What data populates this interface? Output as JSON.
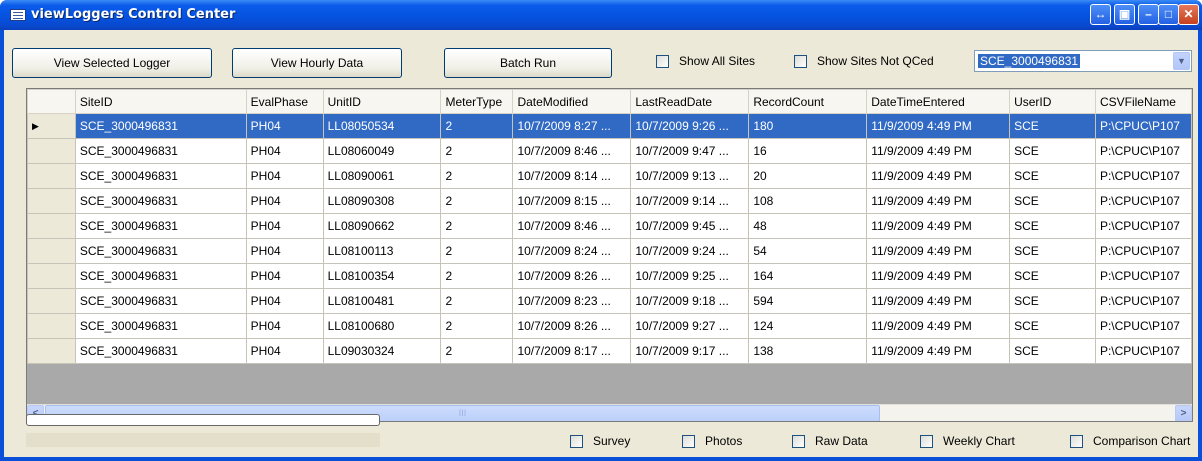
{
  "window": {
    "title": "viewLoggers Control Center"
  },
  "toolbar": {
    "view_selected_logger": "View Selected Logger",
    "view_hourly_data": "View Hourly Data",
    "batch_run": "Batch Run",
    "show_all_sites": "Show All Sites",
    "show_sites_not_qced": "Show Sites Not QCed",
    "site_select_value": "SCE_3000496831"
  },
  "grid": {
    "columns": [
      "SiteID",
      "EvalPhase",
      "UnitID",
      "MeterType",
      "DateModified",
      "LastReadDate",
      "RecordCount",
      "DateTimeEntered",
      "UserID",
      "CSVFileName"
    ],
    "rows": [
      [
        "SCE_3000496831",
        "PH04",
        "LL08050534",
        "2",
        "10/7/2009 8:27 ...",
        "10/7/2009 9:26 ...",
        "180",
        "11/9/2009 4:49 PM",
        "SCE",
        "P:\\CPUC\\P107"
      ],
      [
        "SCE_3000496831",
        "PH04",
        "LL08060049",
        "2",
        "10/7/2009 8:46 ...",
        "10/7/2009 9:47 ...",
        "16",
        "11/9/2009 4:49 PM",
        "SCE",
        "P:\\CPUC\\P107"
      ],
      [
        "SCE_3000496831",
        "PH04",
        "LL08090061",
        "2",
        "10/7/2009 8:14 ...",
        "10/7/2009 9:13 ...",
        "20",
        "11/9/2009 4:49 PM",
        "SCE",
        "P:\\CPUC\\P107"
      ],
      [
        "SCE_3000496831",
        "PH04",
        "LL08090308",
        "2",
        "10/7/2009 8:15 ...",
        "10/7/2009 9:14 ...",
        "108",
        "11/9/2009 4:49 PM",
        "SCE",
        "P:\\CPUC\\P107"
      ],
      [
        "SCE_3000496831",
        "PH04",
        "LL08090662",
        "2",
        "10/7/2009 8:46 ...",
        "10/7/2009 9:45 ...",
        "48",
        "11/9/2009 4:49 PM",
        "SCE",
        "P:\\CPUC\\P107"
      ],
      [
        "SCE_3000496831",
        "PH04",
        "LL08100113",
        "2",
        "10/7/2009 8:24 ...",
        "10/7/2009 9:24 ...",
        "54",
        "11/9/2009 4:49 PM",
        "SCE",
        "P:\\CPUC\\P107"
      ],
      [
        "SCE_3000496831",
        "PH04",
        "LL08100354",
        "2",
        "10/7/2009 8:26 ...",
        "10/7/2009 9:25 ...",
        "164",
        "11/9/2009 4:49 PM",
        "SCE",
        "P:\\CPUC\\P107"
      ],
      [
        "SCE_3000496831",
        "PH04",
        "LL08100481",
        "2",
        "10/7/2009 8:23 ...",
        "10/7/2009 9:18 ...",
        "594",
        "11/9/2009 4:49 PM",
        "SCE",
        "P:\\CPUC\\P107"
      ],
      [
        "SCE_3000496831",
        "PH04",
        "LL08100680",
        "2",
        "10/7/2009 8:26 ...",
        "10/7/2009 9:27 ...",
        "124",
        "11/9/2009 4:49 PM",
        "SCE",
        "P:\\CPUC\\P107"
      ],
      [
        "SCE_3000496831",
        "PH04",
        "LL09030324",
        "2",
        "10/7/2009 8:17 ...",
        "10/7/2009 9:17 ...",
        "138",
        "11/9/2009 4:49 PM",
        "SCE",
        "P:\\CPUC\\P107"
      ]
    ],
    "selected_row": 0,
    "scroll_thumb_glyph": "III"
  },
  "bottom": {
    "survey": "Survey",
    "photos": "Photos",
    "raw_data": "Raw Data",
    "weekly_chart": "Weekly Chart",
    "comparison_chart": "Comparison Chart",
    "progress": 0
  },
  "icons": {
    "title_app": "list-window-icon",
    "caption_extra": "resize-arrows-icon",
    "caption_restore_extra": "window-icon",
    "minimize": "minimize-icon",
    "maximize": "maximize-icon",
    "close": "close-icon",
    "row_pointer": "row-pointer-icon",
    "combo_arrow": "chevron-down-icon",
    "scroll_left": "arrow-left-icon",
    "scroll_right": "arrow-right-icon"
  },
  "colors": {
    "titlebar": "#0552df",
    "selection": "#316ac5",
    "control_bg": "#ece9d8"
  }
}
